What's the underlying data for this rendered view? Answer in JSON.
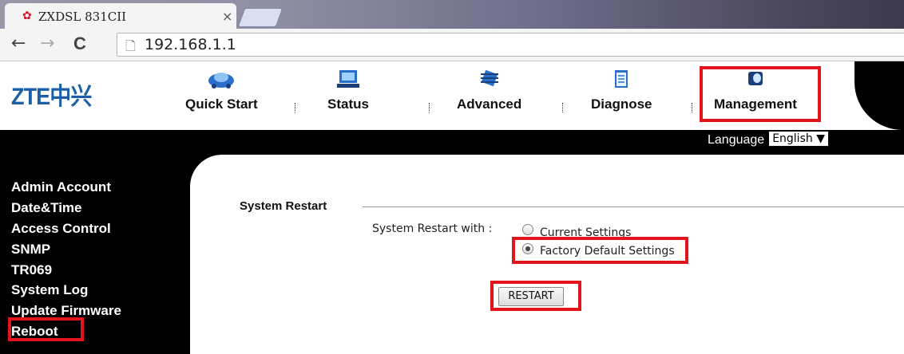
{
  "browser": {
    "tab_title": "ZXDSL 831CII",
    "tab_close": "×",
    "favicon": "huawei-flower-icon",
    "nav": {
      "back": "←",
      "forward": "→",
      "reload": "C"
    },
    "url": "192.168.1.1"
  },
  "header": {
    "logo": "ZTE中兴",
    "nav_items": [
      {
        "label": "Quick Start",
        "icon": "car-icon"
      },
      {
        "label": "Status",
        "icon": "monitor-icon"
      },
      {
        "label": "Advanced",
        "icon": "chip-icon"
      },
      {
        "label": "Diagnose",
        "icon": "clipboard-icon"
      },
      {
        "label": "Management",
        "icon": "management-icon"
      }
    ],
    "separator": "⁞"
  },
  "language": {
    "label": "Language",
    "selected": "English ▼"
  },
  "sidebar": {
    "items": [
      "Admin Account",
      "Date&Time",
      "Access Control",
      "SNMP",
      "TR069",
      "System Log",
      "Update Firmware",
      "Reboot"
    ]
  },
  "main": {
    "section_title": "System Restart",
    "restart_with_label": "System Restart with :",
    "options": [
      "Current Settings",
      "Factory Default Settings"
    ],
    "selected_option": "Factory Default Settings",
    "restart_button": "RESTART"
  },
  "colors": {
    "highlight": "#e1141e",
    "logo_blue": "#1d5ea8"
  }
}
